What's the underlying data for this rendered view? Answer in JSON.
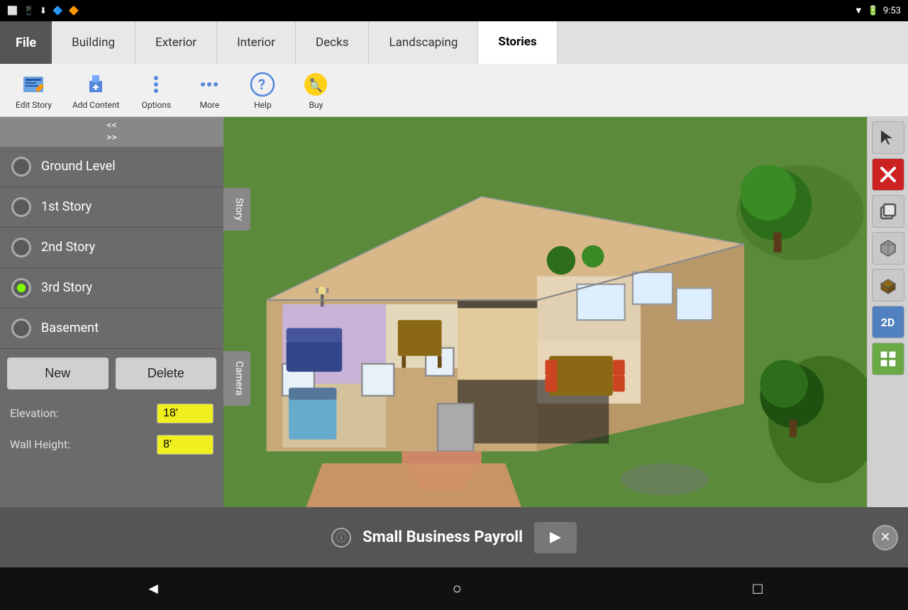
{
  "statusBar": {
    "time": "9:53",
    "leftIcons": [
      "tablet-icon",
      "phone-icon",
      "download-icon",
      "app-icon",
      "app2-icon"
    ],
    "rightIcons": [
      "wifi-icon",
      "battery-icon"
    ]
  },
  "tabs": {
    "file": "File",
    "items": [
      {
        "label": "Building",
        "active": false
      },
      {
        "label": "Exterior",
        "active": false
      },
      {
        "label": "Interior",
        "active": false
      },
      {
        "label": "Decks",
        "active": false
      },
      {
        "label": "Landscaping",
        "active": false
      },
      {
        "label": "Stories",
        "active": true
      }
    ]
  },
  "toolbar": {
    "tools": [
      {
        "id": "edit-story",
        "label": "Edit Story"
      },
      {
        "id": "add-content",
        "label": "Add Content"
      },
      {
        "id": "options",
        "label": "Options"
      },
      {
        "id": "more",
        "label": "More"
      },
      {
        "id": "help",
        "label": "Help"
      },
      {
        "id": "buy",
        "label": "Buy"
      }
    ]
  },
  "leftPanel": {
    "stories": [
      {
        "label": "Ground Level",
        "radio": false,
        "active": false
      },
      {
        "label": "1st Story",
        "radio": false,
        "active": false
      },
      {
        "label": "2nd Story",
        "radio": false,
        "active": false
      },
      {
        "label": "3rd Story",
        "radio": true,
        "active": true
      },
      {
        "label": "Basement",
        "radio": false,
        "active": false
      }
    ],
    "newButton": "New",
    "deleteButton": "Delete",
    "elevation": {
      "label": "Elevation:",
      "value": "18'"
    },
    "wallHeight": {
      "label": "Wall Height:",
      "value": "8'"
    },
    "collapseUp": "<<",
    "collapseDown": ">>",
    "storyTab": "Story",
    "cameraTab": "Camera"
  },
  "rightToolbar": {
    "tools": [
      {
        "id": "cursor",
        "symbol": "↖",
        "label": "cursor"
      },
      {
        "id": "delete",
        "symbol": "✕",
        "label": "delete",
        "color": "red"
      },
      {
        "id": "copy",
        "symbol": "⧉",
        "label": "copy"
      },
      {
        "id": "3d-box",
        "symbol": "◼",
        "label": "3d-box"
      },
      {
        "id": "floor",
        "symbol": "▱",
        "label": "floor"
      },
      {
        "id": "2d",
        "symbol": "2D",
        "label": "2d-view"
      },
      {
        "id": "3d-grid",
        "symbol": "⊞",
        "label": "3d-grid"
      }
    ]
  },
  "adBar": {
    "text": "Small Business Payroll",
    "arrowSymbol": "→",
    "closeSymbol": "✕"
  },
  "navBar": {
    "back": "◄",
    "home": "○",
    "recent": "□"
  }
}
